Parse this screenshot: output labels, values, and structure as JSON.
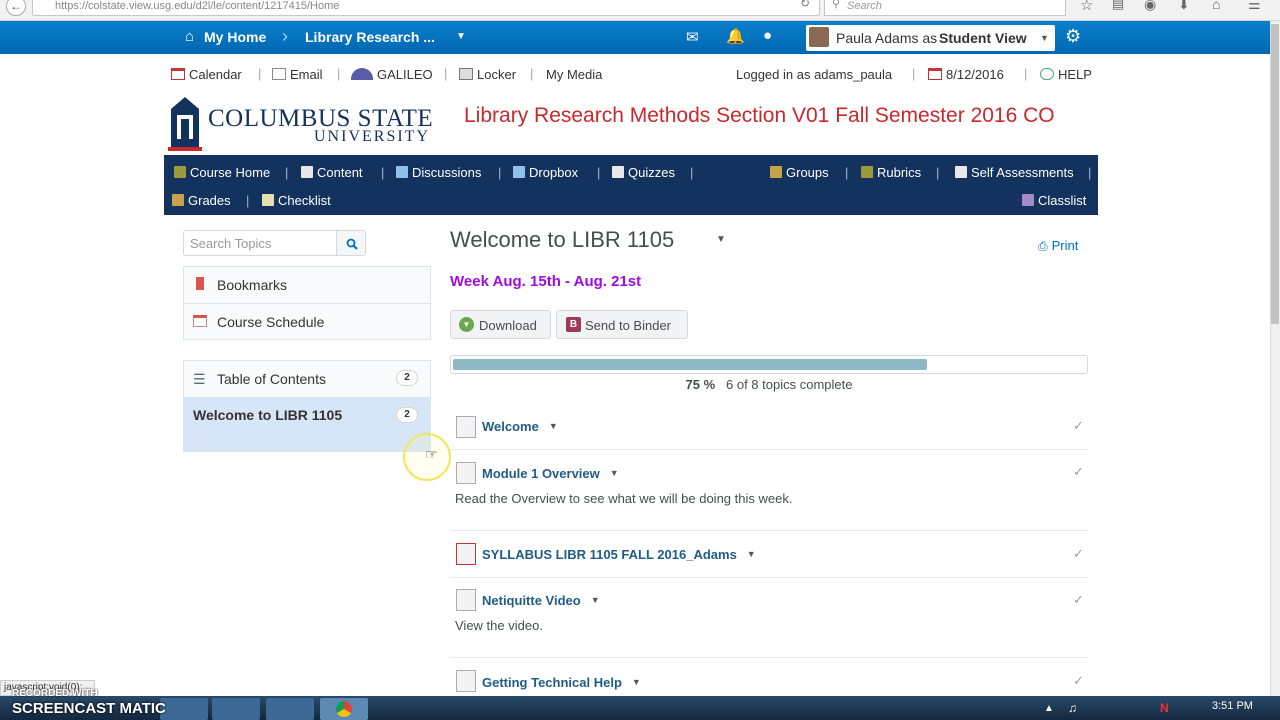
{
  "browser": {
    "url": "https://colstate.view.usg.edu/d2l/le/content/1217415/Home",
    "search_placeholder": "Search"
  },
  "minibar": {
    "home_label": "My Home",
    "course_selector": "Library Research ...",
    "role_user": "Paula Adams as",
    "role_view": "Student View"
  },
  "utility": {
    "calendar": "Calendar",
    "email": "Email",
    "galileo": "GALILEO",
    "locker": "Locker",
    "media": "My Media",
    "logged_in": "Logged in as adams_paula",
    "date": "8/12/2016",
    "help": "HELP"
  },
  "header": {
    "logo_line1": "COLUMBUS STATE",
    "logo_line2": "UNIVERSITY",
    "course_title": "Library Research Methods Section V01 Fall Semester 2016 CO"
  },
  "navbar": {
    "row1": [
      "Course Home",
      "Content",
      "Discussions",
      "Dropbox",
      "Quizzes",
      "Groups",
      "Rubrics",
      "Self Assessments"
    ],
    "row2": [
      "Grades",
      "Checklist",
      "Classlist"
    ]
  },
  "sidebar": {
    "search_placeholder": "Search Topics",
    "bookmarks": "Bookmarks",
    "schedule": "Course Schedule",
    "toc_label": "Table of Contents",
    "toc_count": "2",
    "current_module": "Welcome to LIBR 1105",
    "current_count": "2"
  },
  "main": {
    "title": "Welcome to LIBR 1105",
    "print": "Print",
    "week_heading": "Week Aug. 15th - Aug. 21st",
    "download": "Download",
    "send_to_binder": "Send to Binder",
    "progress_percent": "75 %",
    "progress_value": 0.75,
    "progress_text": "6 of 8 topics complete",
    "topics": [
      {
        "title": "Welcome",
        "desc": ""
      },
      {
        "title": "Module 1 Overview",
        "desc": "Read the Overview to see what we will be doing this week."
      },
      {
        "title": "SYLLABUS LIBR 1105 FALL 2016_Adams",
        "desc": ""
      },
      {
        "title": "Netiquitte Video",
        "desc": "View the video."
      },
      {
        "title": "Getting Technical Help",
        "desc": ""
      }
    ]
  },
  "taskbar": {
    "clock": "3:51 PM",
    "status_url": "javascript:void(0);",
    "watermark_top": "RECORDED WITH",
    "watermark_main": "SCREENCAST MATIC"
  },
  "colors": {
    "minibar": "#0067b3",
    "navbar": "#13325d",
    "course_title": "#c9282d",
    "week_heading": "#9d0ce3",
    "topic_link": "#1f5c87"
  }
}
